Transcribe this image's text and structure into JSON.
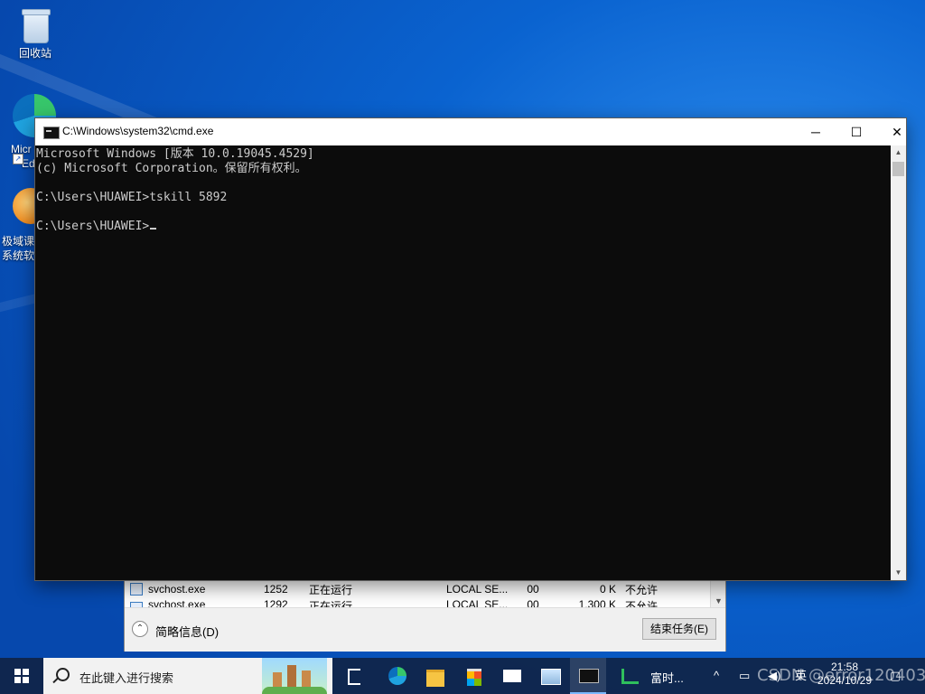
{
  "desktop": {
    "icons": [
      {
        "label": "回收站"
      },
      {
        "label_1": "Micr",
        "label_2": "Ed"
      },
      {
        "label_1": "极域课",
        "label_2": "系统软"
      }
    ]
  },
  "cmd": {
    "title": "C:\\Windows\\system32\\cmd.exe",
    "lines": [
      "Microsoft Windows [版本 10.0.19045.4529]",
      "(c) Microsoft Corporation。保留所有权利。",
      "",
      "C:\\Users\\HUAWEI>tskill 5892",
      "",
      "C:\\Users\\HUAWEI>"
    ],
    "controls": {
      "minimize": "─",
      "maximize": "☐",
      "close": "✕"
    }
  },
  "task_manager": {
    "rows": [
      {
        "name": "svchost.exe",
        "pid": "1252",
        "status": "正在运行",
        "user": "LOCAL SE...",
        "cpu": "00",
        "mem": "0 K",
        "uac": "不允许"
      },
      {
        "name": "svchost.exe",
        "pid": "1292",
        "status": "正在运行",
        "user": "LOCAL SE...",
        "cpu": "00",
        "mem": "1,300 K",
        "uac": "不允许"
      }
    ],
    "brief_label": "简略信息(D)",
    "end_task_label": "结束任务(E)"
  },
  "taskbar": {
    "search_placeholder": "在此键入进行搜索",
    "futu_label": "富时...",
    "tray_chevron": "^",
    "ime": "英",
    "time": "21:58",
    "date": "2024/10/29"
  },
  "watermark": "CSDN @error120403",
  "colors": {
    "console_bg": "#0c0c0c",
    "console_text": "#cccccc",
    "taskbar": "#102446"
  }
}
